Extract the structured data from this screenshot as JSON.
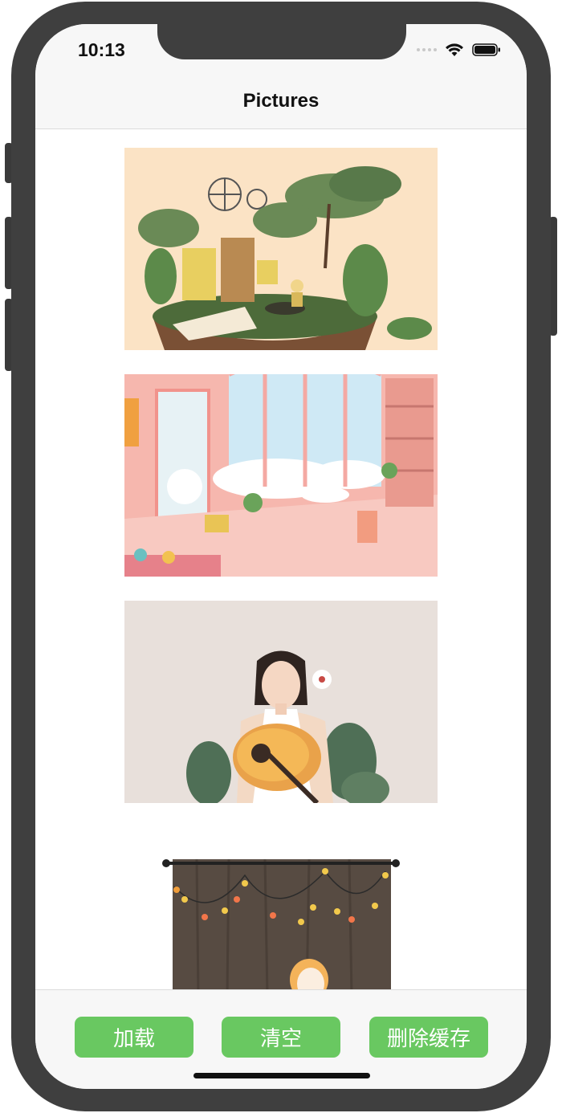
{
  "status_bar": {
    "time": "10:13"
  },
  "nav": {
    "title": "Pictures"
  },
  "pictures": [
    {
      "name": "garden-room-illustration"
    },
    {
      "name": "pink-sunroom-illustration"
    },
    {
      "name": "girl-with-guitar-illustration"
    },
    {
      "name": "curtain-girl-illustration"
    }
  ],
  "toolbar": {
    "load_label": "加载",
    "clear_label": "清空",
    "delete_cache_label": "删除缓存",
    "accent": "#69c861"
  }
}
